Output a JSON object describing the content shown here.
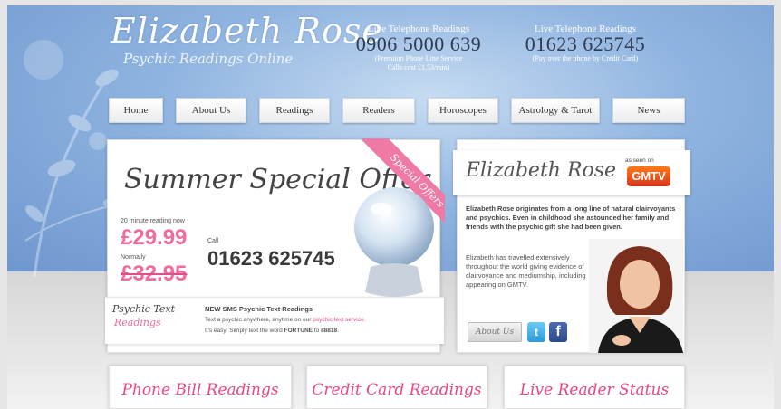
{
  "brand": {
    "title": "Elizabeth Rose",
    "subtitle": "Psychic Readings Online"
  },
  "phones": [
    {
      "label": "Live Telephone Readings",
      "number": "0906 5000 639",
      "note1": "(Premium Phone Line Service",
      "note2": "Calls cost £1.53/min)"
    },
    {
      "label": "Live Telephone Readings",
      "number": "01623 625745",
      "note1": "(Pay over the phone by Credit Card)",
      "note2": ""
    }
  ],
  "nav": [
    "Home",
    "About Us",
    "Readings",
    "Readers",
    "Horoscopes",
    "Astrology & Tarot",
    "News"
  ],
  "offer": {
    "title": "Summer Special Offer",
    "ribbon": "Special Offers",
    "now_label": "20 minute reading now",
    "now_price": "£29.99",
    "old_label": "Normally",
    "old_price": "£32.95",
    "call_label": "Call",
    "call_number": "01623 625745"
  },
  "sms": {
    "logo_top": "Psychic Text",
    "logo_bottom": "Readings",
    "heading": "NEW SMS Psychic Text Readings",
    "line1_pre": "Text a psychic anywhere, anytime on our ",
    "line1_link": "psychic text service.",
    "line2_pre": "It's easy! Simply text the word ",
    "line2_word": "FORTUNE",
    "line2_mid": " to ",
    "line2_num": "88818",
    "line2_end": "."
  },
  "bio": {
    "name": "Elizabeth Rose",
    "seen_on": "as seen on",
    "badge": "GMTV",
    "bold_text": "Elizabeth Rose originates from a long line of natural clairvoyants and psychics. Even in childhood she astounded her family and friends with the psychic gift she had been given.",
    "text": "Elizabeth has travelled extensively throughout the world giving evidence of clairvoyance and mediumship, including appearing on GMTV.",
    "about_button": "About Us",
    "twitter_glyph": "t",
    "facebook_glyph": "f"
  },
  "bottom_cards": [
    "Phone Bill Readings",
    "Credit Card Readings",
    "Live Reader Status"
  ],
  "colors": {
    "accent_pink": "#e8478a",
    "header_blue": "#8fb4e0"
  }
}
